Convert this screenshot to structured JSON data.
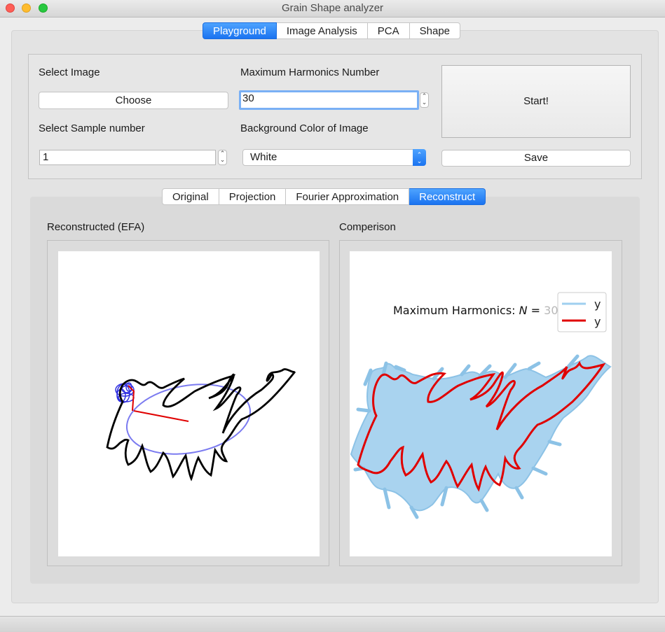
{
  "window": {
    "title": "Grain Shape analyzer"
  },
  "main_tabs": [
    {
      "label": "Playground",
      "active": true
    },
    {
      "label": "Image Analysis",
      "active": false
    },
    {
      "label": "PCA",
      "active": false
    },
    {
      "label": "Shape",
      "active": false
    }
  ],
  "controls": {
    "select_image_label": "Select Image",
    "choose_button": "Choose",
    "max_harmonics_label": "Maximum Harmonics Number",
    "max_harmonics_value": "30",
    "start_button": "Start!",
    "sample_number_label": "Select Sample number",
    "sample_number_value": "1",
    "background_color_label": "Background Color of Image",
    "background_color_value": "White",
    "save_button": "Save"
  },
  "sub_tabs": [
    {
      "label": "Original",
      "active": false
    },
    {
      "label": "Projection",
      "active": false
    },
    {
      "label": "Fourier Approximation",
      "active": false
    },
    {
      "label": "Reconstruct",
      "active": true
    }
  ],
  "plots": {
    "left_title": "Reconstructed (EFA)",
    "right_title": "Comperison",
    "annotation_prefix": "Maximum Harmonics: ",
    "annotation_symbol": "N",
    "annotation_eq": " = ",
    "annotation_value": "30",
    "legend": [
      {
        "label": "y",
        "color": "#9fcfef"
      },
      {
        "label": "y",
        "color": "#e00000"
      }
    ]
  },
  "colors": {
    "accent": "#1a73f0",
    "shape_fill": "#a9d3ef",
    "reconstruction": "#e00000",
    "ellipse": "#7b7bf0",
    "curve": "#000000"
  }
}
